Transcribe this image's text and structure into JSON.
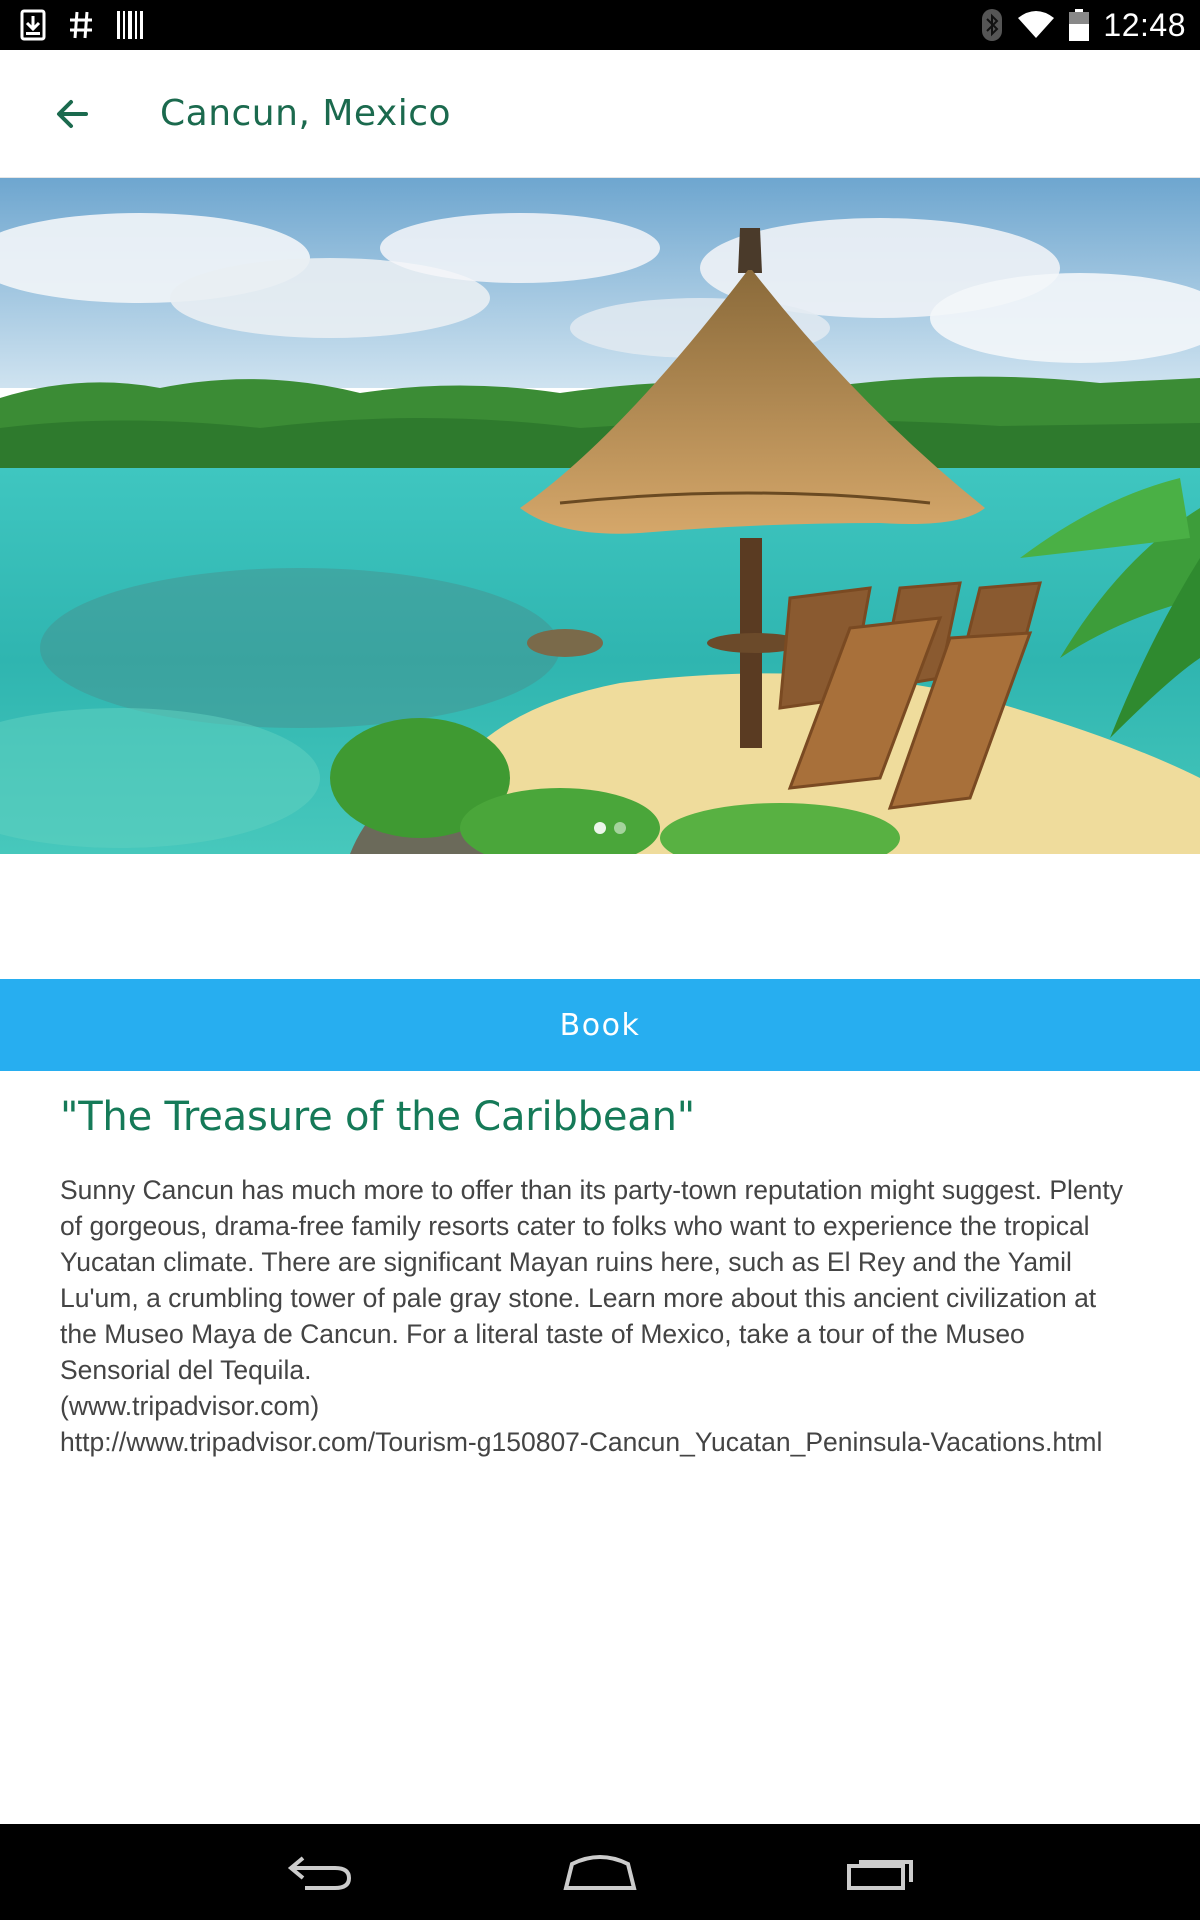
{
  "status_bar": {
    "time": "12:48",
    "icons_left": [
      "download-icon",
      "hash-icon",
      "barcode-icon"
    ],
    "icons_right": [
      "bluetooth-icon",
      "wifi-icon",
      "battery-icon"
    ]
  },
  "app_bar": {
    "title": "Cancun, Mexico",
    "back_icon": "arrow-back-icon"
  },
  "hero": {
    "description_icon": "beach-photo"
  },
  "book_button": {
    "label": "Book"
  },
  "content": {
    "headline": "\"The Treasure of the Caribbean\"",
    "paragraph": "Sunny Cancun has much more to offer than its party-town reputation might suggest. Plenty of gorgeous, drama-free family resorts cater to folks who want to experience the tropical Yucatan climate. There are significant Mayan ruins here, such as El Rey and the Yamil Lu'um, a crumbling tower of pale gray stone. Learn more about this ancient civilization at the Museo Maya de Cancun. For a literal taste of Mexico, take a tour of the Museo Sensorial del Tequila.",
    "source_short": "(www.tripadvisor.com)",
    "source_url": "http://www.tripadvisor.com/Tourism-g150807-Cancun_Yucatan_Peninsula-Vacations.html"
  },
  "nav_bar": {
    "buttons": [
      "back-nav-icon",
      "home-nav-icon",
      "recents-nav-icon"
    ]
  },
  "colors": {
    "accent_green": "#157a58",
    "book_blue": "#27aef0",
    "status_bar": "#000000"
  }
}
